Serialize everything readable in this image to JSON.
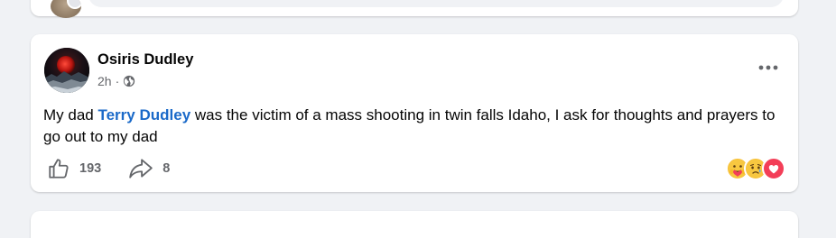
{
  "post": {
    "author": "Osiris Dudley",
    "time": "2h",
    "separator": "·",
    "text_before": "My dad ",
    "mention": "Terry Dudley",
    "text_after": " was the victim of a mass shooting in twin falls Idaho, I ask for thoughts and prayers to go out to my dad",
    "likes": "193",
    "shares": "8"
  },
  "icons": {
    "globe": "globe-icon",
    "more": "more-options-icon",
    "like": "like-thumb-icon",
    "share": "share-arrow-icon",
    "reactions": [
      "care-reaction-icon",
      "sad-reaction-icon",
      "love-reaction-icon"
    ]
  },
  "colors": {
    "mention": "#1b6ac9",
    "love": "#f33e58",
    "secondary_text": "#65676b",
    "background": "#f0f2f5"
  }
}
